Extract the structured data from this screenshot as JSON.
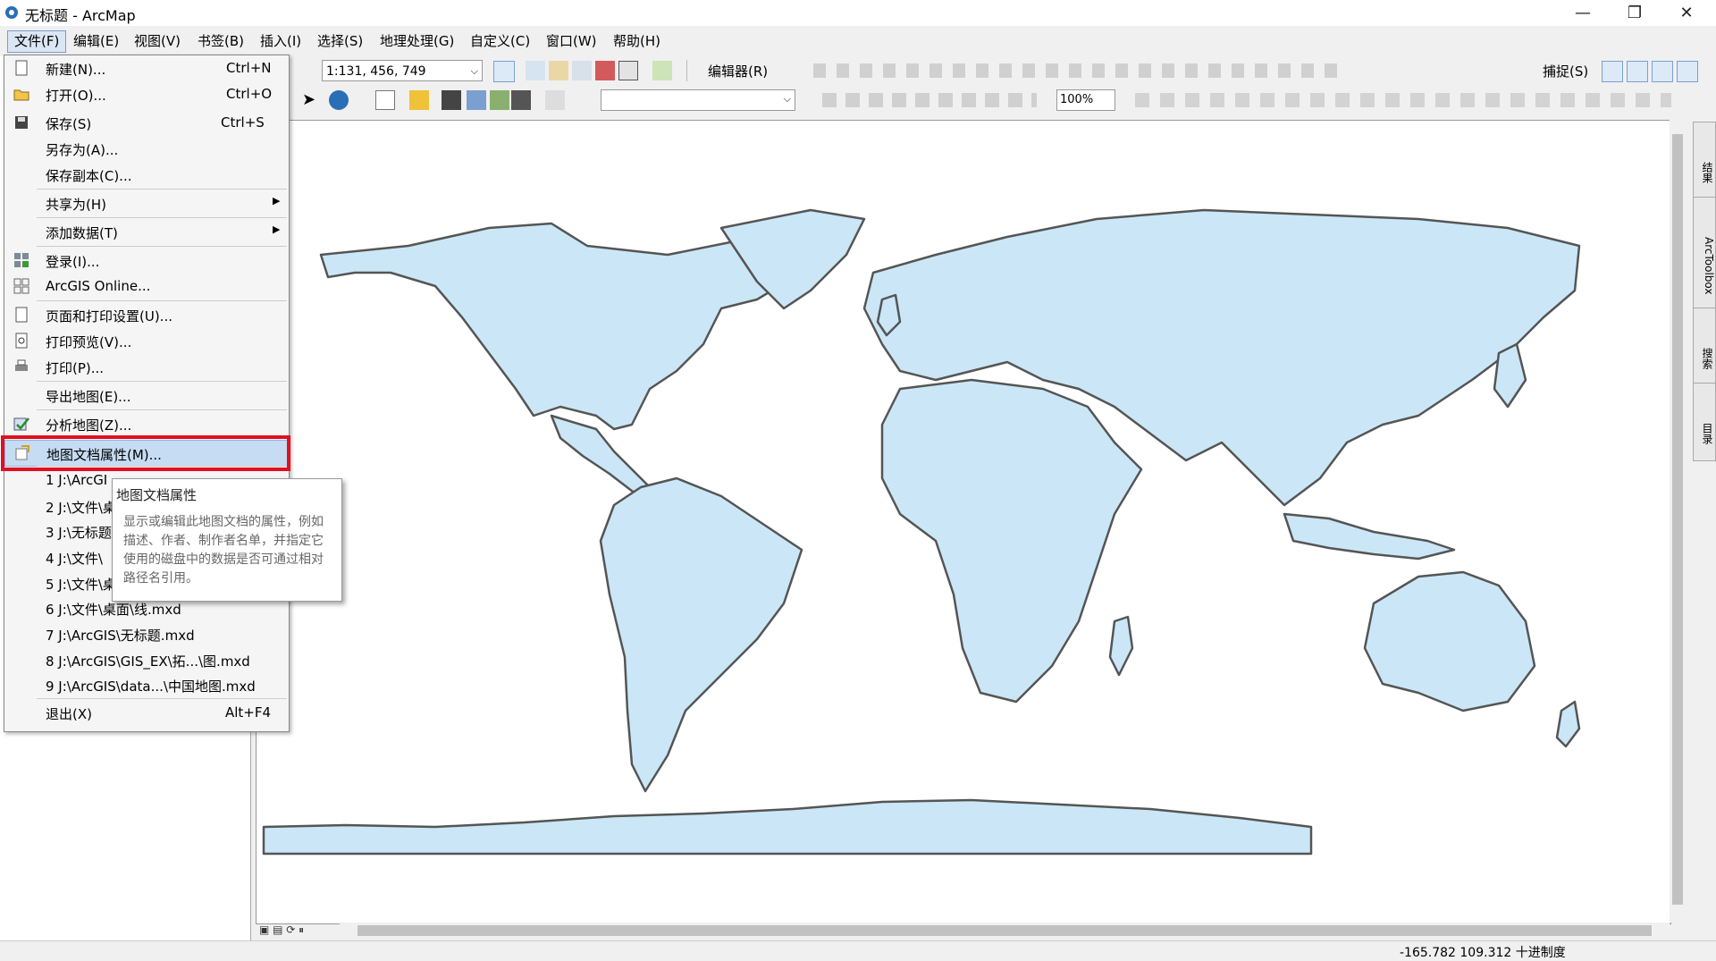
{
  "window": {
    "title": "无标题 - ArcMap",
    "minimize": "—",
    "maximize": "❐",
    "close": "✕"
  },
  "menubar": [
    {
      "label": "文件(F)"
    },
    {
      "label": "编辑(E)"
    },
    {
      "label": "视图(V)"
    },
    {
      "label": "书签(B)"
    },
    {
      "label": "插入(I)"
    },
    {
      "label": "选择(S)"
    },
    {
      "label": "地理处理(G)"
    },
    {
      "label": "自定义(C)"
    },
    {
      "label": "窗口(W)"
    },
    {
      "label": "帮助(H)"
    }
  ],
  "toolbar": {
    "scale": "1:131, 456, 749",
    "editor_label": "编辑器(R)",
    "snap_label": "捕捉(S)",
    "zoom_percent": "100%",
    "layer_combo": ""
  },
  "file_menu": {
    "items": [
      {
        "label": "新建(N)...",
        "shortcut": "Ctrl+N"
      },
      {
        "label": "打开(O)...",
        "shortcut": "Ctrl+O"
      },
      {
        "label": "保存(S)",
        "shortcut": "Ctrl+S"
      },
      {
        "label": "另存为(A)...",
        "shortcut": ""
      },
      {
        "label": "保存副本(C)...",
        "shortcut": ""
      },
      {
        "label": "共享为(H)",
        "shortcut": ""
      },
      {
        "label": "添加数据(T)",
        "shortcut": ""
      },
      {
        "label": "登录(I)...",
        "shortcut": ""
      },
      {
        "label": "ArcGIS Online...",
        "shortcut": ""
      },
      {
        "label": "页面和打印设置(U)...",
        "shortcut": ""
      },
      {
        "label": "打印预览(V)...",
        "shortcut": ""
      },
      {
        "label": "打印(P)...",
        "shortcut": ""
      },
      {
        "label": "导出地图(E)...",
        "shortcut": ""
      },
      {
        "label": "分析地图(Z)...",
        "shortcut": ""
      },
      {
        "label": "地图文档属性(M)...",
        "shortcut": ""
      },
      {
        "label": "1 J:\\ArcGI",
        "shortcut": ""
      },
      {
        "label": "2 J:\\文件\\桌",
        "shortcut": ""
      },
      {
        "label": "3 J:\\无标题",
        "shortcut": ""
      },
      {
        "label": "4 J:\\文件\\",
        "shortcut": ""
      },
      {
        "label": "5 J:\\文件\\桌",
        "shortcut": ""
      },
      {
        "label": "6 J:\\文件\\桌面\\线.mxd",
        "shortcut": ""
      },
      {
        "label": "7 J:\\ArcGIS\\无标题.mxd",
        "shortcut": ""
      },
      {
        "label": "8 J:\\ArcGIS\\GIS_EX\\拓...\\图.mxd",
        "shortcut": ""
      },
      {
        "label": "9 J:\\ArcGIS\\data...\\中国地图.mxd",
        "shortcut": ""
      },
      {
        "label": "退出(X)",
        "shortcut": "Alt+F4"
      }
    ]
  },
  "tooltip": {
    "title": "地图文档属性",
    "body": "显示或编辑此地图文档的属性，例如描述、作者、制作者名单，并指定它使用的磁盘中的数据是否可通过相对路径名引用。"
  },
  "right_dock": [
    {
      "label": "结果"
    },
    {
      "label": "ArcToolbox"
    },
    {
      "label": "搜索"
    },
    {
      "label": "目录"
    }
  ],
  "status": {
    "coords": "-165.782  109.312 十进制度"
  },
  "colors": {
    "land": "#cbe7f7",
    "land_stroke": "#555555",
    "highlight_border": "#e01020"
  }
}
